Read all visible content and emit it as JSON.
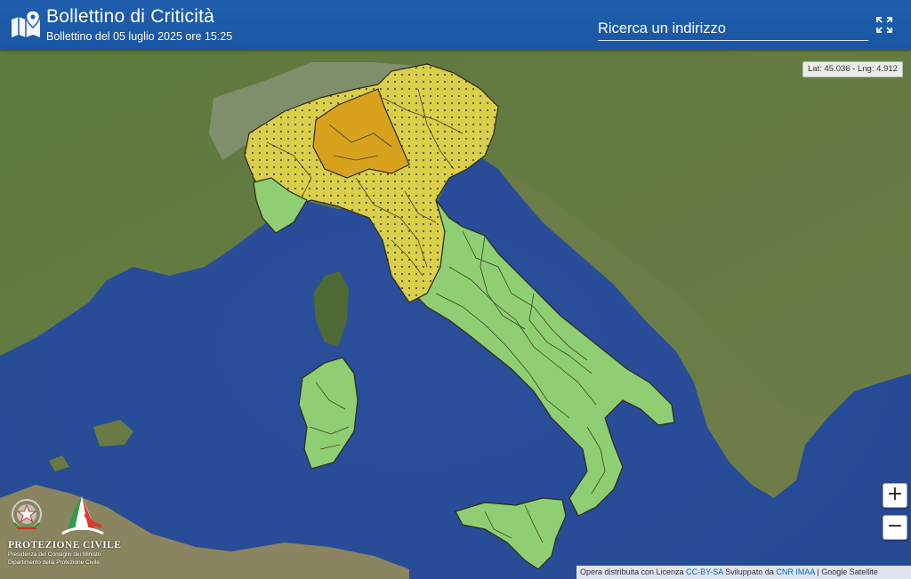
{
  "header": {
    "title": "Bollettino di Criticità",
    "subtitle": "Bollettino del 05 luglio 2025 ore 15:25",
    "search_placeholder": "Ricerca un indirizzo",
    "app_icon": "map-pin-icon",
    "fullscreen_icon": "fullscreen-icon"
  },
  "coordinates_readout": "Lat: 45.036 - Lng: 4.912",
  "zoom": {
    "in_label": "+",
    "out_label": "−"
  },
  "logo": {
    "org_name": "PROTEZIONE CIVILE",
    "org_sub_1": "Presidenza del Consiglio dei Ministri",
    "org_sub_2": "Dipartimento della Protezione Civile"
  },
  "attribution": {
    "prefix": "Opera distribuita con Licenza",
    "license": "CC-BY-SA",
    "middle": "Sviluppato da",
    "developer": "CNR IMAA",
    "separator": "|",
    "basemap": "Google Satellite"
  },
  "legend_colors": {
    "green": "#8fce72",
    "yellow": "#d9cf4a",
    "orange": "#d8a21c",
    "header": "#1f5fae"
  }
}
